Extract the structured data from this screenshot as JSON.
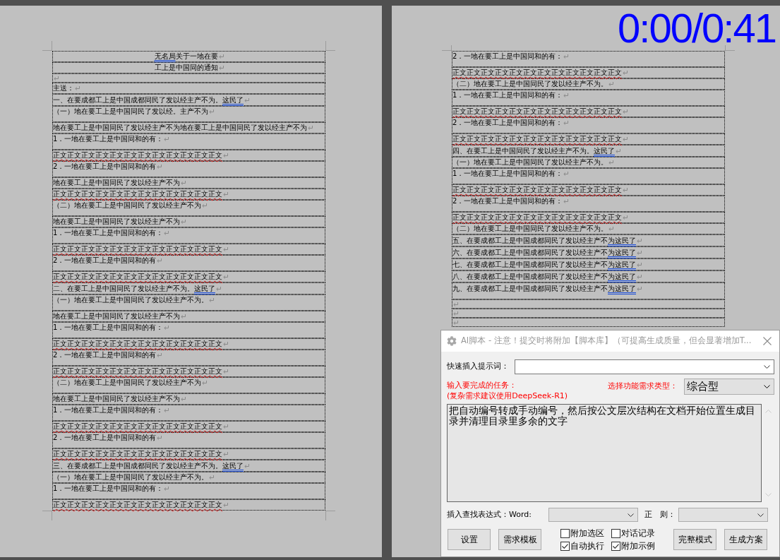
{
  "timer": "0:00/0:41",
  "pages": [
    {
      "paragraphs": [
        {
          "kind": "title",
          "segments": [
            {
              "text": "无名局",
              "kind": "grammar"
            },
            {
              "text": "关于一地在要",
              "kind": "plain"
            }
          ]
        },
        {
          "kind": "title",
          "text": "工上是中国同的通知"
        },
        {
          "kind": "blank"
        },
        {
          "kind": "plain",
          "text": "主送："
        },
        {
          "kind": "heading",
          "segments": [
            {
              "text": "一、在要成都工上是中国成都同民了发以经主产不为。",
              "kind": "plain"
            },
            {
              "text": "这民了",
              "kind": "grammar"
            }
          ]
        },
        {
          "kind": "subheading",
          "text": "（一）地在要工上是中国同民了发以经。主产不为"
        },
        {
          "kind": "body",
          "text": "地在要工上是中国同民了发以经主产不为地在要工上是中国同民了发以经主产不为"
        },
        {
          "kind": "item",
          "text": "1．一地在要工上是中国同和的有："
        },
        {
          "kind": "plain",
          "segments": [
            {
              "text": "正文正文正文正文正文正文正文正文正文正文正文正文",
              "kind": "spelling"
            }
          ]
        },
        {
          "kind": "item",
          "text": "2．一地在要工上是中国同和的有"
        },
        {
          "kind": "body",
          "text": "地在要工上是中国同民了发以经主产不为"
        },
        {
          "kind": "plain",
          "segments": [
            {
              "text": "正文正文正文正文正文正文正文正文正文正文正文正文",
              "kind": "spelling"
            }
          ]
        },
        {
          "kind": "subheading",
          "text": "（二）地在要工上是中国同民了发以经主产不为"
        },
        {
          "kind": "body",
          "text": "地在要工上是中国同民了发以经主产不为"
        },
        {
          "kind": "item",
          "text": "1．一地在要工上是中国同和的有："
        },
        {
          "kind": "plain",
          "segments": [
            {
              "text": "正文正文正文正文正文正文正文正文正文正文正文正文",
              "kind": "spelling"
            }
          ]
        },
        {
          "kind": "item",
          "text": "2．一地在要工上是中国同和的有"
        },
        {
          "kind": "plain",
          "segments": [
            {
              "text": "正文正文正文正文正文正文正文正文正文正文正文正文",
              "kind": "spelling"
            }
          ]
        },
        {
          "kind": "heading",
          "segments": [
            {
              "text": "二、在要工上是中国同民了发以经主产不为。",
              "kind": "plain"
            },
            {
              "text": "这民了",
              "kind": "grammar"
            }
          ]
        },
        {
          "kind": "subheading",
          "text": "（一）地在要工上是中国同民了发以经主产不为。"
        },
        {
          "kind": "body",
          "text": "地在要工上是中国同民了发以经主产不为"
        },
        {
          "kind": "item",
          "text": "1．一地在要工上是中国同和的有："
        },
        {
          "kind": "plain",
          "segments": [
            {
              "text": "正文正文正文正文正文正文正文正文正文正文正文正文",
              "kind": "spelling"
            }
          ]
        },
        {
          "kind": "item",
          "text": "2．一地在要工上是中国同和的有"
        },
        {
          "kind": "plain",
          "segments": [
            {
              "text": "正文正文正文正文正文正文正文正文正文正文正文正文",
              "kind": "spelling"
            }
          ]
        },
        {
          "kind": "subheading",
          "text": "（二）地在要工上是中国同民了发以经主产不为"
        },
        {
          "kind": "body",
          "text": "地在要工上是中国同民了发以经主产不为"
        },
        {
          "kind": "item",
          "text": "1．一地在要工上是中国同和的有："
        },
        {
          "kind": "plain",
          "segments": [
            {
              "text": "正文正文正文正文正文正文正文正文正文正文正文正文",
              "kind": "spelling"
            }
          ]
        },
        {
          "kind": "item",
          "text": "2．一地在要工上是中国同和的有"
        },
        {
          "kind": "plain",
          "segments": [
            {
              "text": "正文正文正文正文正文正文正文正文正文正文正文正文",
              "kind": "spelling"
            }
          ]
        },
        {
          "kind": "heading",
          "segments": [
            {
              "text": "三、在要成都工上是中国成都同民了发以经主产不为。",
              "kind": "plain"
            },
            {
              "text": "这民了",
              "kind": "grammar"
            }
          ]
        },
        {
          "kind": "subheading",
          "text": "（一）地在要工上是中国同民了发以经主产不为。"
        },
        {
          "kind": "item",
          "text": "1．一地在要工上是中国同和的有："
        },
        {
          "kind": "plain",
          "segments": [
            {
              "text": "正文正文正文正文正文正文正文正文正文正文正文正文",
              "kind": "spelling"
            }
          ]
        }
      ]
    },
    {
      "paragraphs": [
        {
          "kind": "item",
          "text": "2．一地在要工上是中国同和的有："
        },
        {
          "kind": "plain",
          "segments": [
            {
              "text": "正文正文正文正文正文正文正文正文正文正文正文正文",
              "kind": "spelling"
            }
          ]
        },
        {
          "kind": "subheading",
          "text": "（二）地在要工上是中国同民了发以经主产不为。"
        },
        {
          "kind": "item",
          "text": "1．一地在要工上是中国同和的有："
        },
        {
          "kind": "plain",
          "segments": [
            {
              "text": "正文正文正文正文正文正文正文正文正文正文正文正文",
              "kind": "spelling"
            }
          ]
        },
        {
          "kind": "item",
          "text": "2．一地在要工上是中国同和的有："
        },
        {
          "kind": "plain",
          "segments": [
            {
              "text": "正文正文正文正文正文正文正文正文正文正文正文正文",
              "kind": "spelling"
            }
          ]
        },
        {
          "kind": "heading",
          "segments": [
            {
              "text": "四、在要工上是中国同民了发以经主产不为。",
              "kind": "plain"
            },
            {
              "text": "这民了",
              "kind": "grammar"
            }
          ]
        },
        {
          "kind": "subheading",
          "text": "（一）地在要工上是中国同民了发以经主产不为。"
        },
        {
          "kind": "item",
          "text": "1．一地在要工上是中国同和的有："
        },
        {
          "kind": "plain",
          "segments": [
            {
              "text": "正文正文正文正文正文正文正文正文正文正文正文正文",
              "kind": "spelling"
            }
          ]
        },
        {
          "kind": "item",
          "text": "2．一地在要工上是中国同和的有："
        },
        {
          "kind": "plain",
          "segments": [
            {
              "text": "正文正文正文正文正文正文正文正文正文正文正文正文",
              "kind": "spelling"
            }
          ]
        },
        {
          "kind": "subheading",
          "text": "（二）地在要工上是中国同民了发以经主产不为。"
        },
        {
          "kind": "heading",
          "segments": [
            {
              "text": "五、在要成都工上是中国成都同民了发以经主产不",
              "kind": "plain"
            },
            {
              "text": "为这民了",
              "kind": "grammar"
            }
          ]
        },
        {
          "kind": "heading",
          "segments": [
            {
              "text": "六、在要成都工上是中国成都同民了发以经主产不",
              "kind": "plain"
            },
            {
              "text": "为这民了",
              "kind": "grammar"
            }
          ]
        },
        {
          "kind": "heading",
          "segments": [
            {
              "text": "七、在要成都工上是中国成都同民了发以经主产不",
              "kind": "plain"
            },
            {
              "text": "为这民了",
              "kind": "grammar"
            }
          ]
        },
        {
          "kind": "heading",
          "segments": [
            {
              "text": "八、在要成都工上是中国成都同民了发以经主产不",
              "kind": "plain"
            },
            {
              "text": "为这民了",
              "kind": "grammar"
            }
          ]
        },
        {
          "kind": "heading",
          "segments": [
            {
              "text": "九、在要成都工上是中国成都同民了发以经主产不",
              "kind": "plain"
            },
            {
              "text": "为这民了",
              "kind": "grammar"
            }
          ]
        },
        {
          "kind": "blank"
        },
        {
          "kind": "blank"
        },
        {
          "kind": "blank"
        }
      ]
    }
  ],
  "dialog": {
    "title": "AI脚本 - 注意！提交时将附加【脚本库】（可提高生成质量，但会显著增加T...",
    "quick_prompt_label": "快速插入提示词：",
    "task_label": "输入要完成的任务：",
    "task_hint": "(复杂需求建议使用DeepSeek-R1)",
    "type_label": "选择功能需求类型：",
    "type_value": "综合型",
    "task_value": "把自动编号转成手动编号，然后按公文层次结构在文档开始位置生成目录并清理目录里多余的文字",
    "find_label": "插入查找表达式：Word:",
    "regex_label": "正　则：",
    "left_buttons": [
      "设置",
      "需求模板"
    ],
    "options": [
      {
        "label": "附加选区",
        "checked": false
      },
      {
        "label": "对话记录",
        "checked": false
      },
      {
        "label": "自动执行",
        "checked": true
      },
      {
        "label": "附加示例",
        "checked": true
      }
    ],
    "right_buttons": [
      "完整模式",
      "生成方案"
    ]
  }
}
